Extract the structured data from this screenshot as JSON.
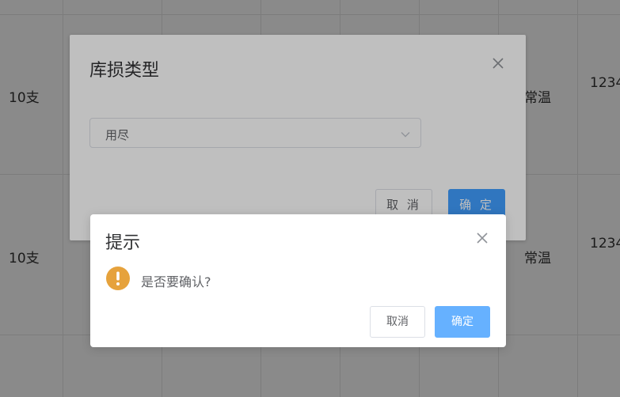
{
  "table": {
    "rows": [
      {
        "qty": "10支",
        "storage": "常温",
        "code": "1234"
      },
      {
        "qty": "10支",
        "storage": "常温",
        "code": "1234"
      }
    ]
  },
  "dialog": {
    "title": "库损类型",
    "select_value": "用尽",
    "cancel_label": "取 消",
    "confirm_label": "确 定"
  },
  "message_box": {
    "title": "提示",
    "message": "是否要确认?",
    "cancel_label": "取消",
    "confirm_label": "确定",
    "icon": "warning-icon",
    "icon_color": "#e6a23c"
  }
}
